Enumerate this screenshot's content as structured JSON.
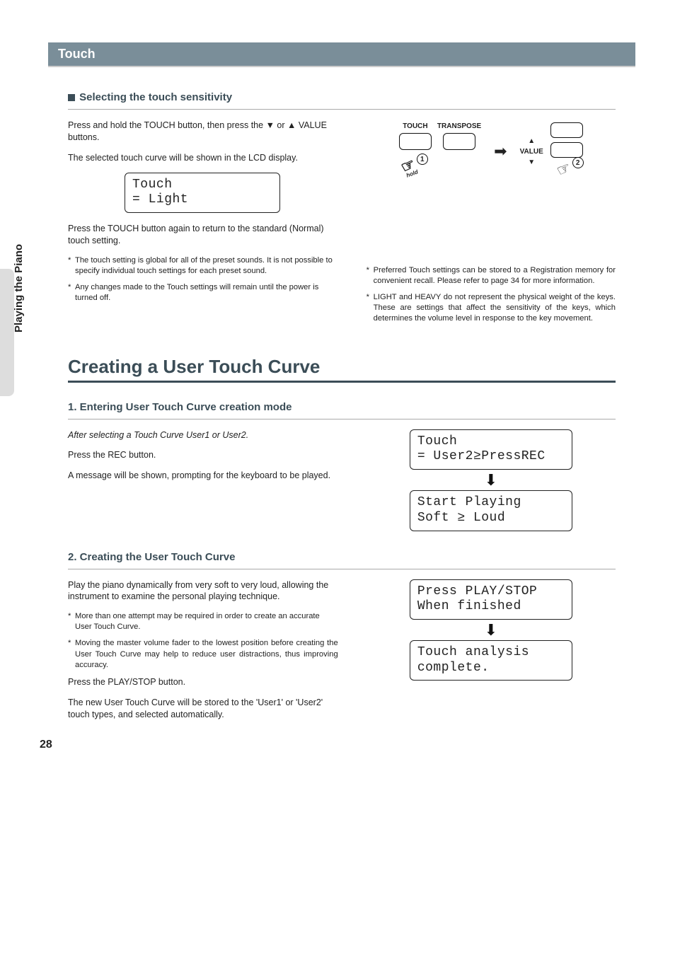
{
  "sideTab": "Playing the Piano",
  "sectionBar": "Touch",
  "selecting": {
    "heading": "Selecting the touch sensitivity",
    "p1_a": "Press and hold the TOUCH button, then press the ",
    "p1_b": " or ",
    "p1_c": " VALUE buttons.",
    "p2": "The selected touch curve will be shown in the LCD display.",
    "lcd_l1": "Touch",
    "lcd_l2": "= Light",
    "p3": "Press the TOUCH button again to return to the standard (Normal) touch setting.",
    "leftNote1": "The touch setting is global for all of the preset sounds. It is not possible to specify individual touch settings for each preset sound.",
    "leftNote2": "Any changes made to the Touch settings will remain until the power is turned off.",
    "rightNote1": "Preferred Touch settings can be stored to a Registration memory for convenient recall.  Please refer to page 34 for more information.",
    "rightNote2": "LIGHT and HEAVY do not represent the physical weight of the keys. These are settings that affect the sensitivity of the keys, which determines the volume level in response to the key movement.",
    "labelTouch": "TOUCH",
    "labelTranspose": "TRANSPOSE",
    "labelValue": "VALUE",
    "hold": "hold",
    "badge1": "1",
    "badge2": "2"
  },
  "creating": {
    "title": "Creating a User Touch Curve",
    "step1": {
      "heading": "1. Entering User Touch Curve creation mode",
      "p1": "After selecting a Touch Curve User1 or User2.",
      "p2": "Press the REC button.",
      "p3": "A message will be shown, prompting for the keyboard to be played.",
      "lcd1_l1": "Touch",
      "lcd1_l2": "= User2≥PressREC",
      "lcd2_l1": "Start Playing",
      "lcd2_l2": "Soft ≥ Loud"
    },
    "step2": {
      "heading": "2. Creating the User Touch Curve",
      "p1": "Play the piano dynamically from very soft to very loud, allowing the instrument to examine the personal playing technique.",
      "note1": "More than one attempt may be required in order to create an accurate User Touch Curve.",
      "note2": "Moving the master volume fader to the lowest position before creating the User Touch Curve may help to reduce user distractions, thus improving accuracy.",
      "p2": "Press the PLAY/STOP button.",
      "p3": "The new User Touch Curve will be stored to the 'User1' or 'User2' touch types, and selected automatically.",
      "lcd1_l1": "Press PLAY/STOP",
      "lcd1_l2": "When finished",
      "lcd2_l1": "Touch analysis",
      "lcd2_l2": "complete."
    }
  },
  "pageNumber": "28"
}
